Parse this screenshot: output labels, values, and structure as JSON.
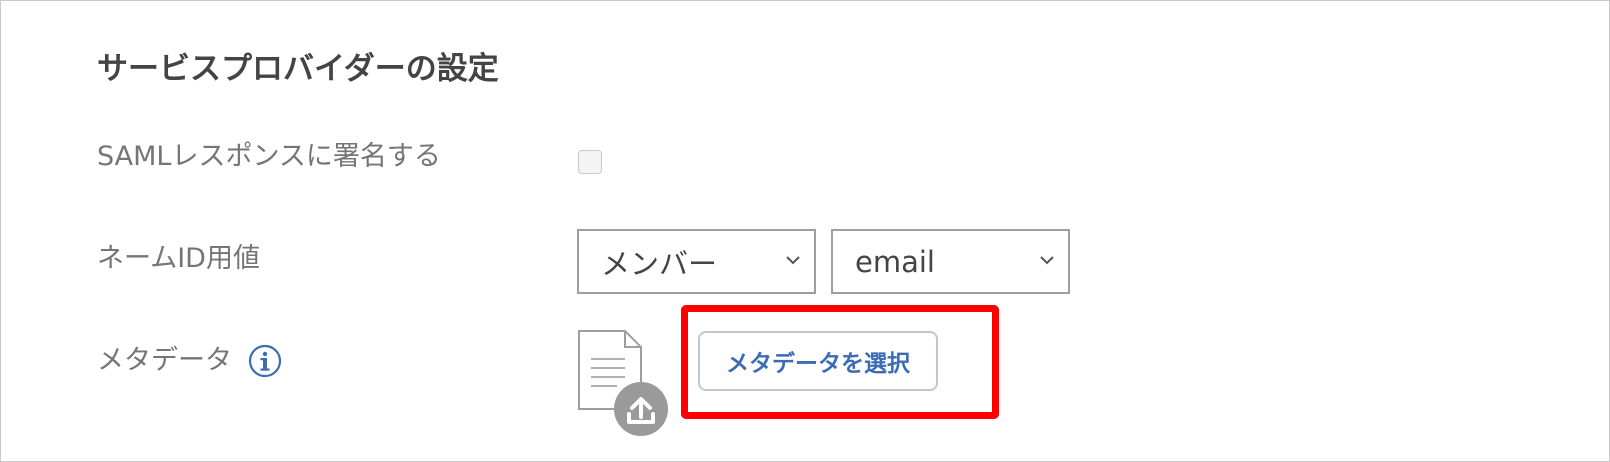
{
  "section": {
    "title": "サービスプロバイダーの設定"
  },
  "rows": {
    "saml_sign": {
      "label": "SAMLレスポンスに署名する",
      "checked": false
    },
    "name_id": {
      "label": "ネームID用値",
      "source_select": {
        "selected": "メンバー"
      },
      "attribute_select": {
        "selected": "email"
      }
    },
    "metadata": {
      "label": "メタデータ",
      "info_icon": "info-circle-icon",
      "file_icon": "document-upload-icon",
      "button_label": "メタデータを選択"
    }
  },
  "colors": {
    "accent": "#3b6cb5",
    "highlight": "#ff0000",
    "label": "#757575",
    "title": "#444444"
  }
}
